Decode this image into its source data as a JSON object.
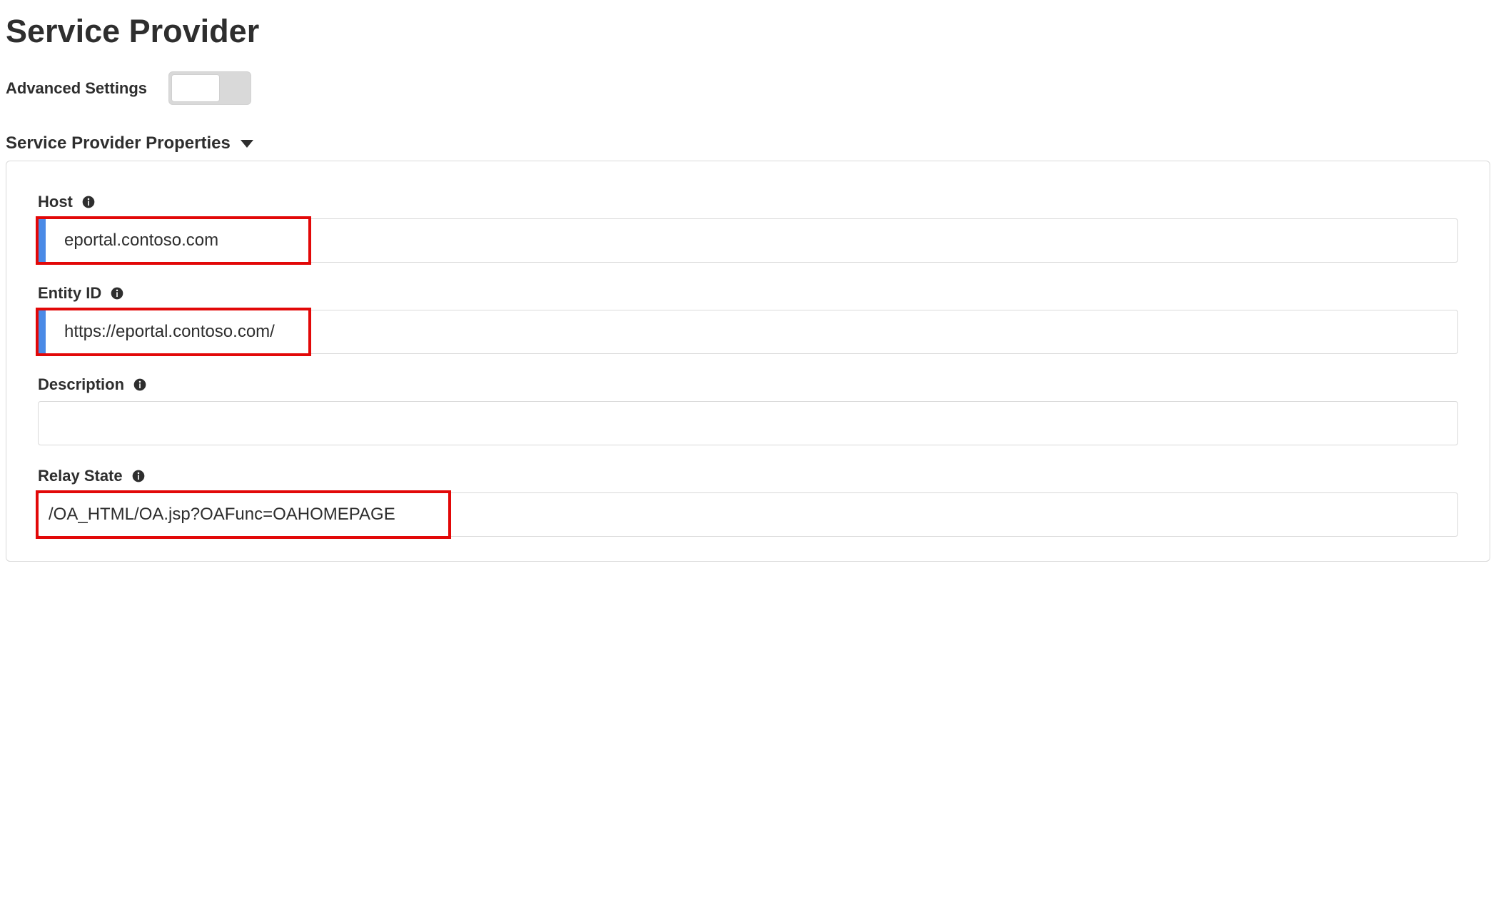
{
  "page": {
    "title": "Service Provider"
  },
  "advanced": {
    "label": "Advanced Settings",
    "toggled": false
  },
  "section": {
    "title": "Service Provider Properties"
  },
  "fields": {
    "host": {
      "label": "Host",
      "value": "eportal.contoso.com"
    },
    "entityId": {
      "label": "Entity ID",
      "value": "https://eportal.contoso.com/"
    },
    "description": {
      "label": "Description",
      "value": ""
    },
    "relayState": {
      "label": "Relay State",
      "value": "/OA_HTML/OA.jsp?OAFunc=OAHOMEPAGE"
    }
  }
}
